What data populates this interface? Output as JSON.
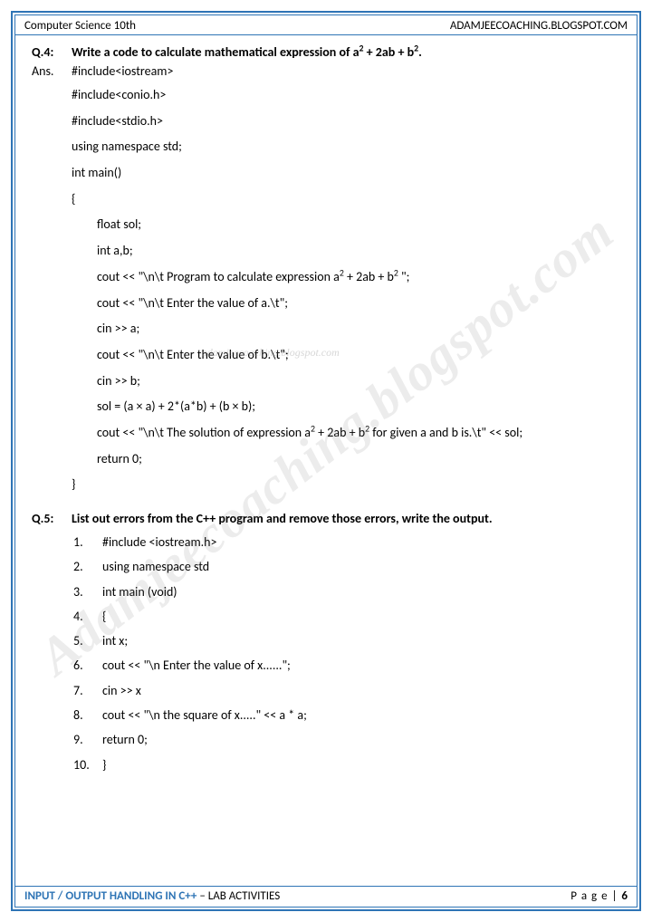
{
  "header": {
    "left": "Computer Science 10th",
    "right": "ADAMJEECOACHING.BLOGSPOT.COM"
  },
  "q4": {
    "label": "Q.4:",
    "question_pre": "Write a code to calculate mathematical expression of a",
    "question_mid1": " + 2ab + b",
    "question_end": ".",
    "ans_label": "Ans.",
    "lines": {
      "l1": "#include<iostream>",
      "l2": "#include<conio.h>",
      "l3": "#include<stdio.h>",
      "l4": "using namespace std;",
      "l5": "int main()",
      "l6": "{",
      "l7": "float sol;",
      "l8": "int a,b;",
      "l9a": "cout << \"\\n\\t Program to calculate expression a",
      "l9b": " + 2ab + b",
      "l9c": " \";",
      "l10": "cout << \"\\n\\t Enter the value of a.\\t\";",
      "l11": "cin >> a;",
      "l12": "cout << \"\\n\\t Enter the value of b.\\t\";",
      "l13": "cin >> b;",
      "l14": "sol = (a × a) + 2*(a*b) + (b × b);",
      "l15a": "cout << \"\\n\\t The solution of expression a",
      "l15b": " + 2ab + b",
      "l15c": " for given a and b is.\\t\" << sol;",
      "l16": "return 0;",
      "l17": "}"
    }
  },
  "q5": {
    "label": "Q.5:",
    "question": "List out errors from the C++ program and remove those errors, write the output.",
    "items": {
      "n1": "1.",
      "c1": "#include <iostream.h>",
      "n2": "2.",
      "c2": "using namespace std",
      "n3": "3.",
      "c3": "int main (void)",
      "n4": "4.",
      "c4": "{",
      "n5": "5.",
      "c5": "int x;",
      "n6": "6.",
      "c6": "cout << \"\\n Enter the value of x......\";",
      "n7": "7.",
      "c7": "cin >> x",
      "n8": "8.",
      "c8": "cout << \"\\n the square of x.....\" << a * a;",
      "n9": "9.",
      "c9": "return 0;",
      "n10": "10.",
      "c10": "}"
    }
  },
  "footer": {
    "left_bold": "INPUT / OUTPUT HANDLING IN C++",
    "left_rest": " – LAB ACTIVITIES",
    "page_label": "P a g e  | ",
    "page_num": "6"
  },
  "watermark": "Adamjeecoaching.blogspot.com",
  "watermark_small": "adamjeecoaching.blogspot.com"
}
